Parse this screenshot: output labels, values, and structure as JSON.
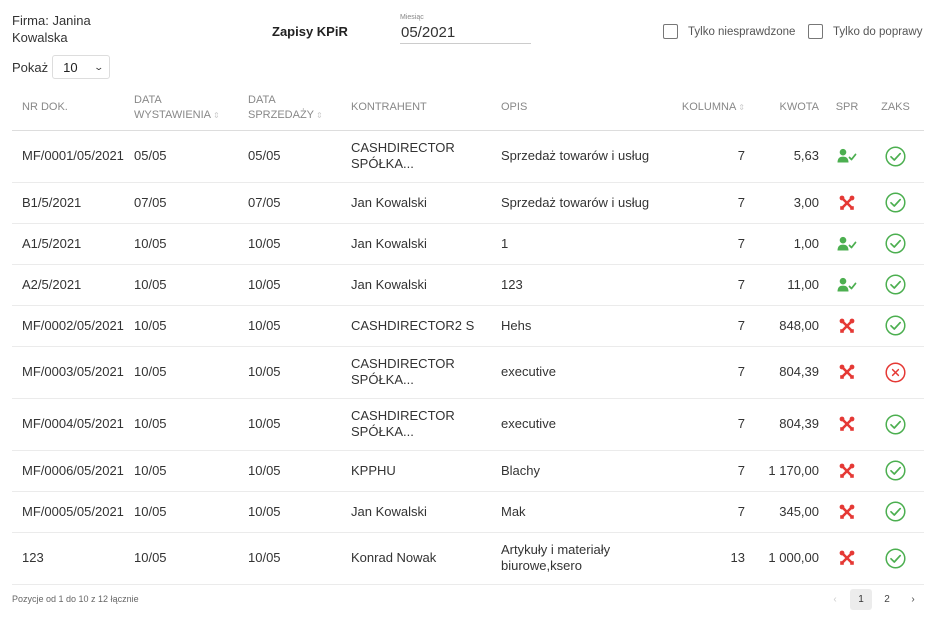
{
  "header": {
    "firm": "Firma: Janina Kowalska",
    "title": "Zapisy KPiR",
    "month_label": "Miesiąc",
    "month_value": "05/2021",
    "filter_unchecked_label": "Tylko niesprawdzone",
    "filter_fix_label": "Tylko do poprawy",
    "show_label": "Pokaż",
    "show_value": "10"
  },
  "table": {
    "columns": {
      "nr": "NR DOK.",
      "data_wyst": "DATA WYSTAWIENIA",
      "data_sprz": "DATA SPRZEDAŻY",
      "kontrahent": "KONTRAHENT",
      "opis": "OPIS",
      "kolumna": "KOLUMNA",
      "kwota": "KWOTA",
      "spr": "SPR",
      "zaks": "ZAKS"
    },
    "rows": [
      {
        "nr": "MF/0001/05/2021",
        "data_wyst": "05/05",
        "data_sprz": "05/05",
        "kontrahent": "CASHDIRECTOR SPÓŁKA...",
        "opis": "Sprzedaż towarów i usług",
        "kolumna": "7",
        "kwota": "5,63",
        "spr": "user-check-icon",
        "zaks": "check-circle-icon"
      },
      {
        "nr": "B1/5/2021",
        "data_wyst": "07/05",
        "data_sprz": "07/05",
        "kontrahent": "Jan Kowalski",
        "opis": "Sprzedaż towarów i usług",
        "kolumna": "7",
        "kwota": "3,00",
        "spr": "tools-icon",
        "zaks": "check-circle-icon"
      },
      {
        "nr": "A1/5/2021",
        "data_wyst": "10/05",
        "data_sprz": "10/05",
        "kontrahent": "Jan Kowalski",
        "opis": "1",
        "kolumna": "7",
        "kwota": "1,00",
        "spr": "user-check-icon",
        "zaks": "check-circle-icon"
      },
      {
        "nr": "A2/5/2021",
        "data_wyst": "10/05",
        "data_sprz": "10/05",
        "kontrahent": "Jan Kowalski",
        "opis": "123",
        "kolumna": "7",
        "kwota": "11,00",
        "spr": "user-check-icon",
        "zaks": "check-circle-icon"
      },
      {
        "nr": "MF/0002/05/2021",
        "data_wyst": "10/05",
        "data_sprz": "10/05",
        "kontrahent": "CASHDIRECTOR2 S",
        "opis": "Hehs",
        "kolumna": "7",
        "kwota": "848,00",
        "spr": "tools-icon",
        "zaks": "check-circle-icon"
      },
      {
        "nr": "MF/0003/05/2021",
        "data_wyst": "10/05",
        "data_sprz": "10/05",
        "kontrahent": "CASHDIRECTOR SPÓŁKA...",
        "opis": "executive",
        "kolumna": "7",
        "kwota": "804,39",
        "spr": "tools-icon",
        "zaks": "x-circle-icon"
      },
      {
        "nr": "MF/0004/05/2021",
        "data_wyst": "10/05",
        "data_sprz": "10/05",
        "kontrahent": "CASHDIRECTOR SPÓŁKA...",
        "opis": "executive",
        "kolumna": "7",
        "kwota": "804,39",
        "spr": "tools-icon",
        "zaks": "check-circle-icon"
      },
      {
        "nr": "MF/0006/05/2021",
        "data_wyst": "10/05",
        "data_sprz": "10/05",
        "kontrahent": "KPPHU",
        "opis": "Blachy",
        "kolumna": "7",
        "kwota": "1 170,00",
        "spr": "tools-icon",
        "zaks": "check-circle-icon"
      },
      {
        "nr": "MF/0005/05/2021",
        "data_wyst": "10/05",
        "data_sprz": "10/05",
        "kontrahent": "Jan Kowalski",
        "opis": "Mak",
        "kolumna": "7",
        "kwota": "345,00",
        "spr": "tools-icon",
        "zaks": "check-circle-icon"
      },
      {
        "nr": "123",
        "data_wyst": "10/05",
        "data_sprz": "10/05",
        "kontrahent": "Konrad Nowak",
        "opis": "Artykuły i materiały biurowe,ksero",
        "kolumna": "13",
        "kwota": "1 000,00",
        "spr": "tools-icon",
        "zaks": "check-circle-icon"
      }
    ]
  },
  "footer": {
    "info": "Pozycje od 1 do 10 z 12 łącznie",
    "prev": "‹",
    "pages": [
      "1",
      "2"
    ],
    "next": "›"
  },
  "colors": {
    "ok_green": "#4caf50",
    "error_red": "#e53935"
  }
}
